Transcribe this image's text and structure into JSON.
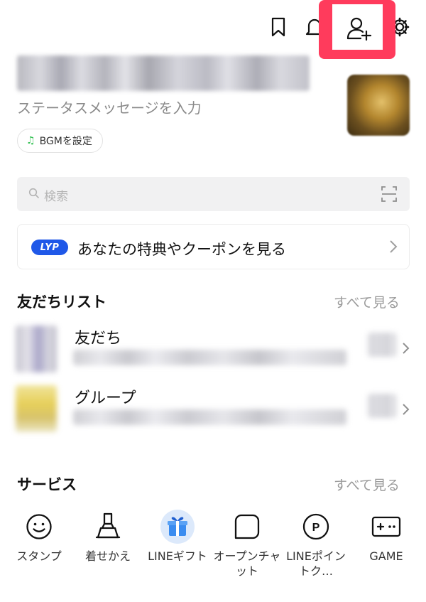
{
  "header": {
    "icons": [
      "bookmark-icon",
      "bell-icon",
      "add-friend-icon",
      "gear-icon"
    ],
    "highlight_color": "#ff3b5c"
  },
  "profile": {
    "status_placeholder": "ステータスメッセージを入力",
    "bgm_label": "BGMを設定"
  },
  "search": {
    "placeholder": "検索"
  },
  "coupon": {
    "badge": "LYP",
    "text": "あなたの特典やクーポンを見る",
    "badge_color": "#1f58e8"
  },
  "friends_section": {
    "title": "友だちリスト",
    "see_all": "すべて見る",
    "rows": [
      {
        "title": "友だち"
      },
      {
        "title": "グループ"
      }
    ]
  },
  "services_section": {
    "title": "サービス",
    "see_all": "すべて見る",
    "items": [
      {
        "label": "スタンプ",
        "icon": "smiley-icon"
      },
      {
        "label": "着せかえ",
        "icon": "brush-icon"
      },
      {
        "label": "LINEギフト",
        "icon": "gift-icon"
      },
      {
        "label": "オープンチャット",
        "icon": "open-chat-icon"
      },
      {
        "label": "LINEポイントク…",
        "icon": "points-icon"
      },
      {
        "label": "GAME",
        "icon": "game-icon"
      }
    ]
  }
}
